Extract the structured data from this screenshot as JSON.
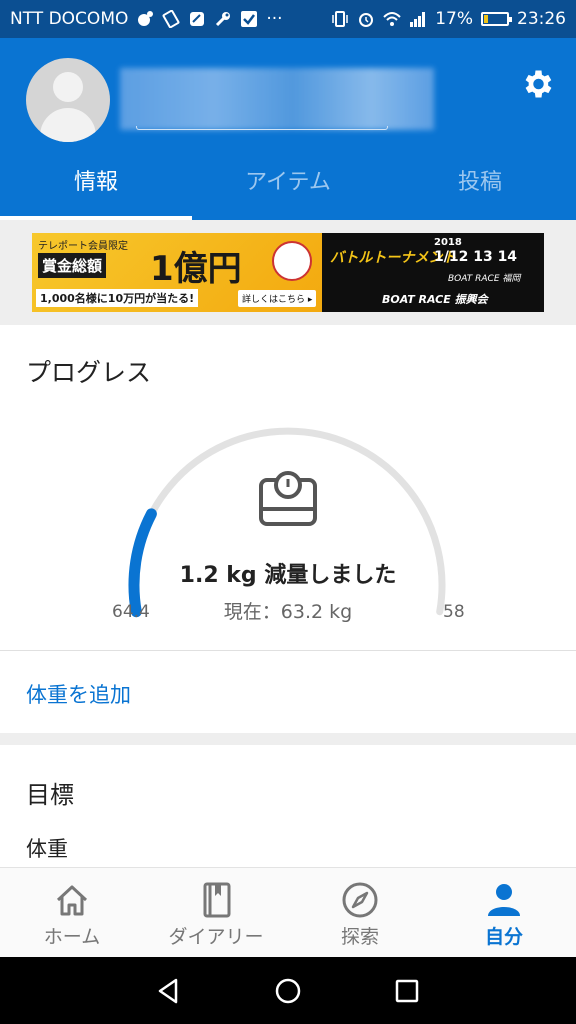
{
  "status_bar": {
    "carrier": "NTT DOCOMO",
    "battery_percent": "17%",
    "battery_level": 0.17,
    "time": "23:26",
    "overflow": "···",
    "icons": [
      "data-saver-icon",
      "rotation-icon",
      "app-icon",
      "wrench-icon",
      "checkbox-icon",
      "vibrate-icon",
      "alarm-icon",
      "wifi-icon",
      "signal-icon",
      "battery-icon"
    ]
  },
  "header": {
    "tabs": [
      {
        "label": "情報",
        "active": true
      },
      {
        "label": "アイテム",
        "active": false
      },
      {
        "label": "投稿",
        "active": false
      }
    ],
    "settings_icon": "gear-icon"
  },
  "banner": {
    "left_tag": "テレポート会員限定",
    "left_main": "賞金総額",
    "left_big": "1億円",
    "left_sub": "1,000名様に10万円が当たる!",
    "left_detail": "詳しくはこちら ▸",
    "right_title": "バトルトーナメント",
    "right_year": "2018",
    "right_dates": "1/12 13 14",
    "right_place": "BOAT RACE 福岡",
    "right_org": "BOAT RACE 振興会"
  },
  "progress": {
    "title": "プログレス",
    "lost_text": "1.2 kg 減量しました",
    "current_text": "現在：63.2 kg",
    "start_value": "64.4",
    "goal_value": "58",
    "progress_fraction": 0.1875,
    "add_weight_label": "体重を追加",
    "colors": {
      "track": "#e2e2e2",
      "fill": "#0a74d2"
    }
  },
  "goal": {
    "title": "目標",
    "row_label": "体重"
  },
  "bottom_nav": [
    {
      "label": "ホーム",
      "icon": "home-icon",
      "active": false
    },
    {
      "label": "ダイアリー",
      "icon": "diary-icon",
      "active": false
    },
    {
      "label": "探索",
      "icon": "compass-icon",
      "active": false
    },
    {
      "label": "自分",
      "icon": "person-icon",
      "active": true
    }
  ],
  "colors": {
    "primary": "#0a74d2",
    "status_bar": "#0b4f92"
  }
}
